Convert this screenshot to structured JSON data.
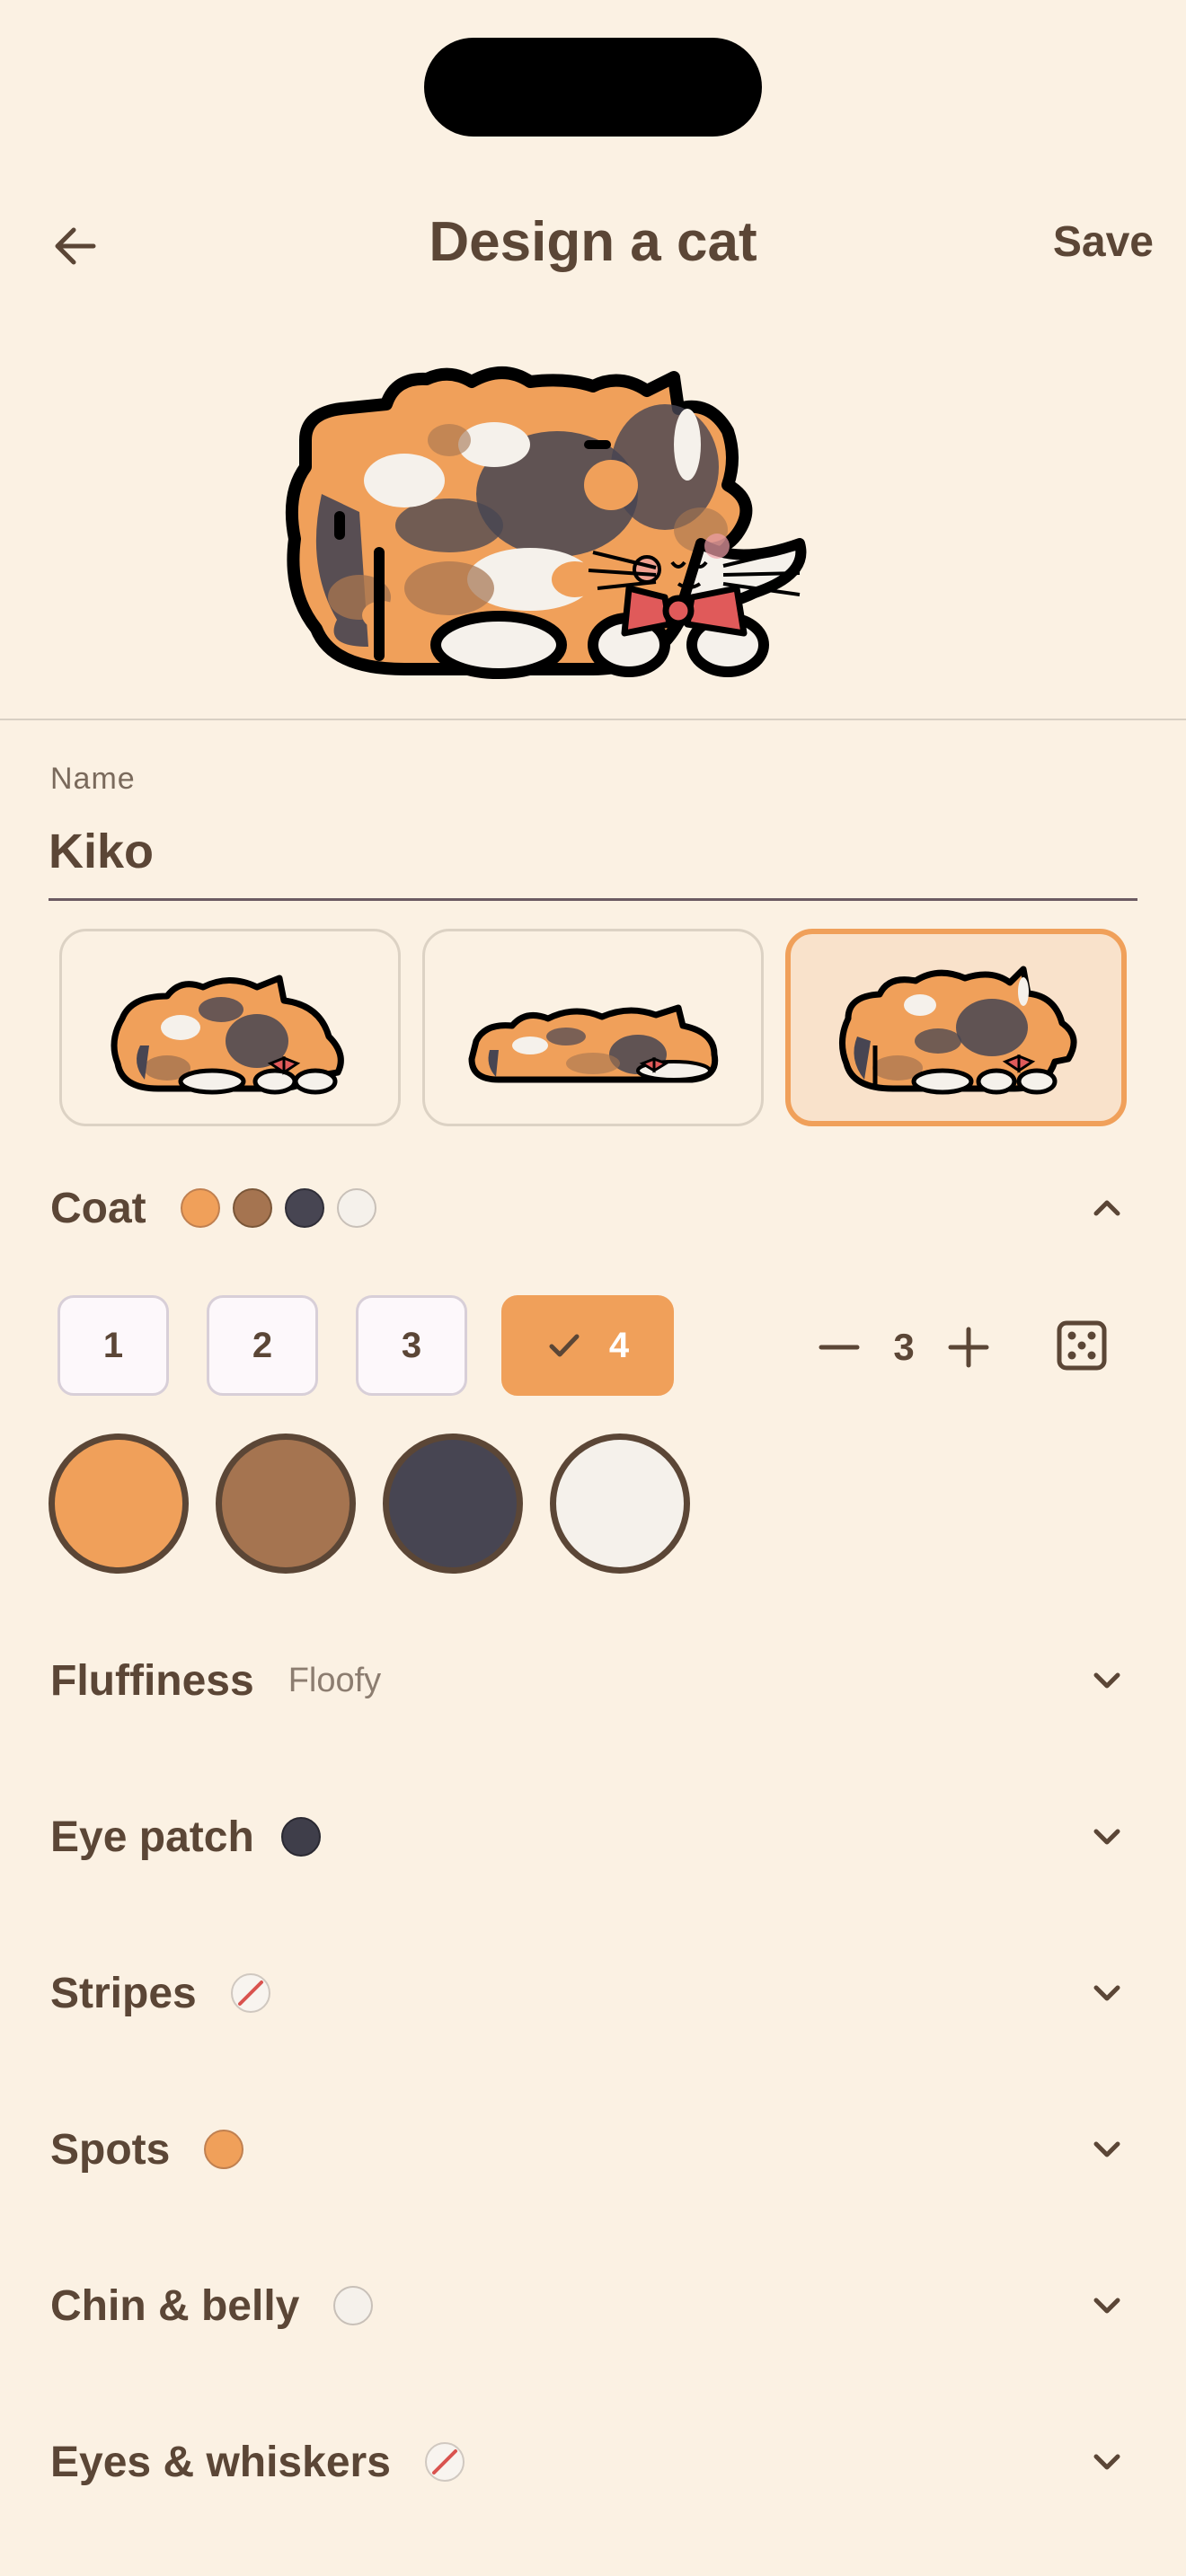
{
  "header": {
    "title": "Design a cat",
    "save_label": "Save"
  },
  "name_field": {
    "label": "Name",
    "value": "Kiko"
  },
  "sections": {
    "coat": {
      "title": "Coat",
      "colors": [
        "#f0a05a",
        "#a57450",
        "#474552",
        "#f5f1eb"
      ]
    },
    "fluffiness": {
      "title": "Fluffiness",
      "value": "Floofy"
    },
    "eye_patch": {
      "title": "Eye patch",
      "color": "#3f3e4a"
    },
    "stripes": {
      "title": "Stripes",
      "swatch": "none"
    },
    "spots": {
      "title": "Spots",
      "color": "#f0a05a"
    },
    "chin_belly": {
      "title": "Chin & belly",
      "color": "#f5f1eb"
    },
    "eyes_whiskers": {
      "title": "Eyes & whiskers",
      "swatch": "none"
    }
  },
  "coat_count": {
    "options": [
      "1",
      "2",
      "3",
      "4"
    ],
    "selected": "4"
  },
  "stepper": {
    "value": "3"
  },
  "icons": {
    "back": "arrow-left-icon",
    "expand": "chevron-down-icon",
    "collapse": "chevron-up-icon",
    "minus": "minus-icon",
    "plus": "plus-icon",
    "random": "dice-icon",
    "check": "check-icon"
  }
}
